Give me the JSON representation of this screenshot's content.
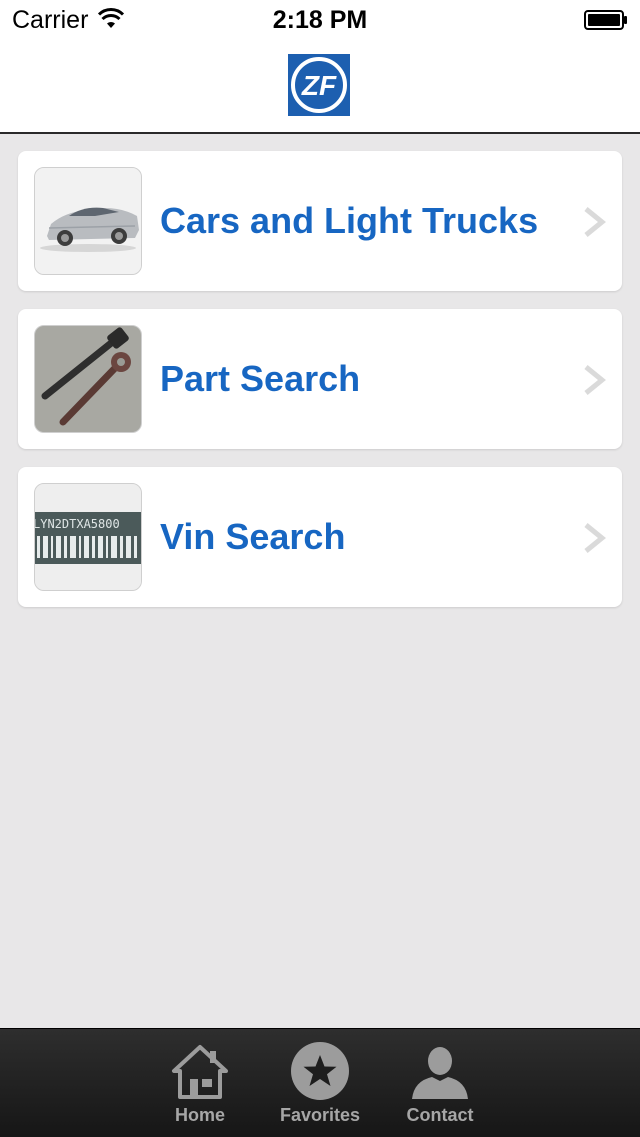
{
  "status_bar": {
    "carrier": "Carrier",
    "time": "2:18 PM"
  },
  "header": {
    "logo_text": "ZF",
    "logo_color": "#1d5fb0"
  },
  "menu": {
    "items": [
      {
        "label": "Cars and Light Trucks",
        "icon": "car-thumbnail"
      },
      {
        "label": "Part Search",
        "icon": "wrench-thumbnail"
      },
      {
        "label": "Vin Search",
        "icon": "vin-barcode-thumbnail"
      }
    ]
  },
  "tab_bar": {
    "tabs": [
      {
        "label": "Home",
        "icon": "home-icon"
      },
      {
        "label": "Favorites",
        "icon": "star-icon"
      },
      {
        "label": "Contact",
        "icon": "person-icon"
      }
    ]
  },
  "thumbnails": {
    "vin_text": "LYN2DTXA5800"
  },
  "colors": {
    "label_blue": "#1766c2",
    "background": "#e8e7e8",
    "tab_label": "#a6a6a6"
  }
}
